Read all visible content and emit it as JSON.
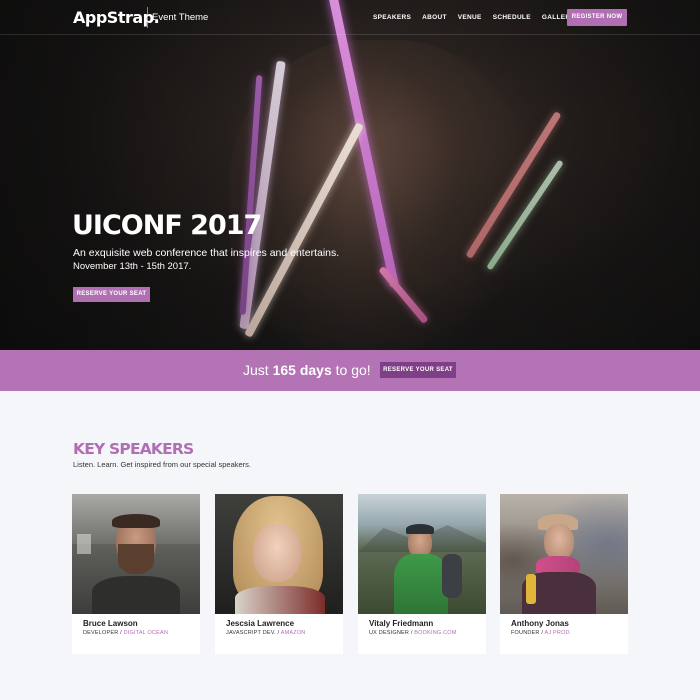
{
  "nav": {
    "brand": "AppStrap.",
    "subtitle": "Event Theme",
    "links": [
      "SPEAKERS",
      "ABOUT",
      "VENUE",
      "SCHEDULE",
      "GALLERY"
    ],
    "cta": "REGISTER NOW"
  },
  "hero": {
    "title": "UICONF 2017",
    "subtitle": "An exquisite web conference that inspires and entertains.",
    "dates": "November 13th - 15th 2017.",
    "button": "RESERVE YOUR SEAT"
  },
  "countdown": {
    "prefix": "Just",
    "days": "165 days",
    "suffix": "to go!",
    "button": "RESERVE YOUR SEAT"
  },
  "speakers": {
    "title": "KEY SPEAKERS",
    "subtitle": "Listen. Learn. Get inspired from our special speakers.",
    "items": [
      {
        "name": "Bruce Lawson",
        "role": "DEVELOPER / ",
        "company": "DIGITAL OCEAN"
      },
      {
        "name": "Jescsia Lawrence",
        "role": "JAVASCRIPT DEV. / ",
        "company": "AMAZON"
      },
      {
        "name": "Vitaly Friedmann",
        "role": "UX DESIGNER / ",
        "company": "BOOKING.COM"
      },
      {
        "name": "Anthony Jonas",
        "role": "FOUNDER / ",
        "company": "AJ PROD."
      }
    ]
  },
  "colors": {
    "accent": "#b06eb3",
    "countdown_bg": "#b373b4",
    "countdown_button": "#7f3f86",
    "page_bg": "#f4f6f9"
  }
}
